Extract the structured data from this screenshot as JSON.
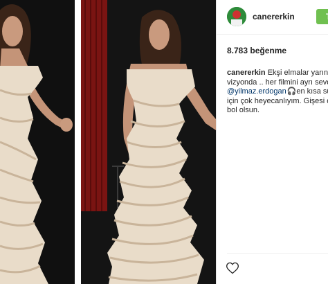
{
  "post": {
    "username": "canererkin",
    "follow_label": "T",
    "likes": "8.783 beğenme",
    "caption": {
      "username": "canererkin",
      "line1": "Ekşi elmalar yarından",
      "line2": "vizyonda .. her filmini ayrı sevdiğ",
      "mention": "@yilmaz.erdogan",
      "line3_rest": " 🎧en kısa süre",
      "line4": "için çok heyecanlıyım. Gişesi de",
      "line5": "bol olsun."
    }
  },
  "icons": {
    "heart": "heart-outline-icon",
    "avatar": "profile-avatar"
  },
  "colors": {
    "follow": "#70c050",
    "mention": "#003569",
    "curtain": "#7a1412"
  }
}
